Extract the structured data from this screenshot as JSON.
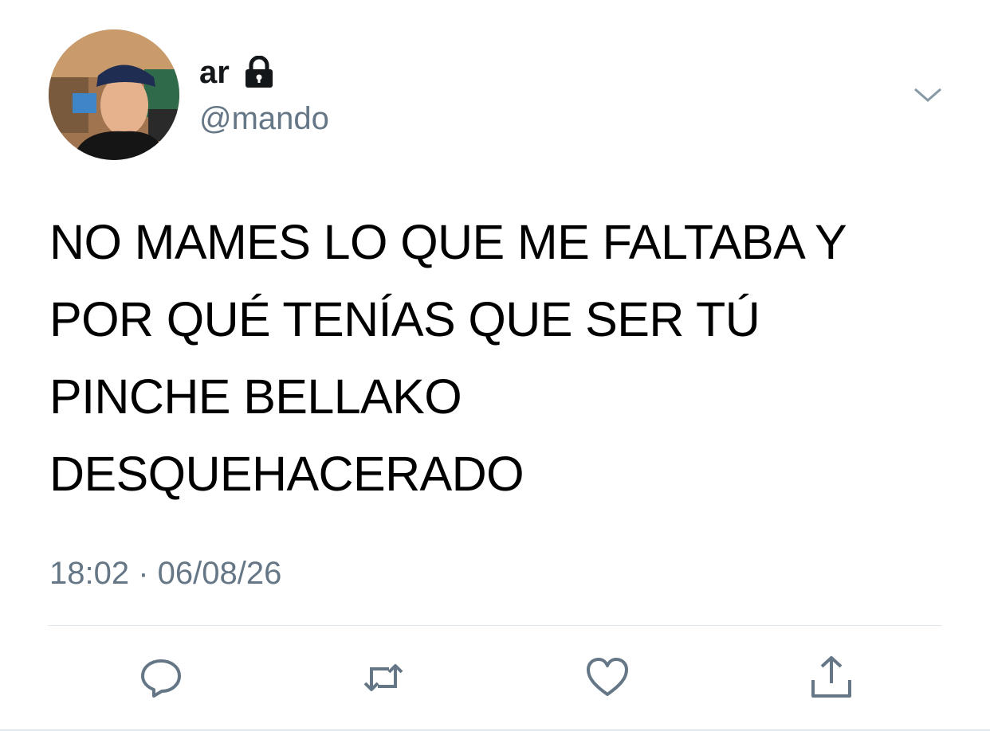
{
  "author": {
    "display_name": "ar",
    "handle": "@mando",
    "avatar_icon": "profile-photo",
    "protected_icon": "lock-icon"
  },
  "tweet": {
    "text": "NO MAMES LO QUE ME FALTABA Y\nPOR QUÉ TENÍAS QUE SER TÚ\nPINCHE BELLAKO\nDESQUEHACERADO",
    "timestamp": "18:02 · 06/08/26"
  },
  "actions": [
    {
      "name": "reply",
      "icon": "speech-bubble-icon"
    },
    {
      "name": "retweet",
      "icon": "retweet-icon"
    },
    {
      "name": "like",
      "icon": "heart-icon"
    },
    {
      "name": "share",
      "icon": "share-icon"
    }
  ],
  "colors": {
    "text": "#14171a",
    "secondary": "#657786",
    "icon": "#657786",
    "divider": "#e1e8ed"
  }
}
